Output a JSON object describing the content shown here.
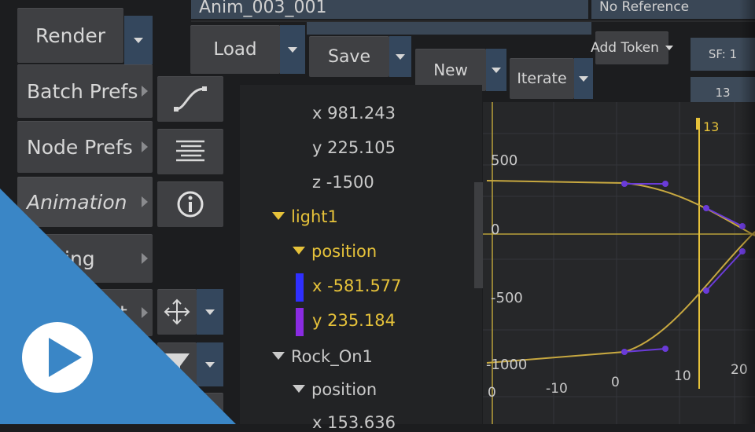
{
  "header": {
    "name_field": "Anim_003_001",
    "reference_field": "No Reference",
    "add_token_label": "Add Token",
    "sf_field": "SF: 1",
    "frame_field": "13"
  },
  "file_buttons": {
    "load": "Load",
    "save": "Save",
    "new": "New",
    "iterate": "Iterate"
  },
  "menu": {
    "render": "Render",
    "batch_prefs": "Batch Prefs",
    "node_prefs": "Node Prefs",
    "animation": "Animation",
    "partial_4": "ing",
    "partial_5": "t"
  },
  "tree": {
    "x_val": "x 981.243",
    "y_val": "y 225.105",
    "z_val": "z -1500",
    "light1": "light1",
    "position1": "position",
    "light_x": "x -581.577",
    "light_y": "y 235.184",
    "rock": "Rock_On1",
    "position2": "position",
    "partial_last": "x 153.636"
  },
  "graph": {
    "current_frame": "13",
    "y_labels": [
      "500",
      "0",
      "-500",
      "-1000"
    ],
    "x_labels": [
      "0",
      "-10",
      "0",
      "10",
      "20"
    ]
  },
  "colors": {
    "accent_yellow": "#e6c23a",
    "channel_x": "#2f2fff",
    "channel_y": "#8a2be2",
    "play_overlay": "#3a86c6"
  },
  "icons": {
    "curve": "curve-icon",
    "align": "align-lines-icon",
    "info": "info-icon",
    "move": "move-arrows-icon",
    "play": "play-icon"
  }
}
